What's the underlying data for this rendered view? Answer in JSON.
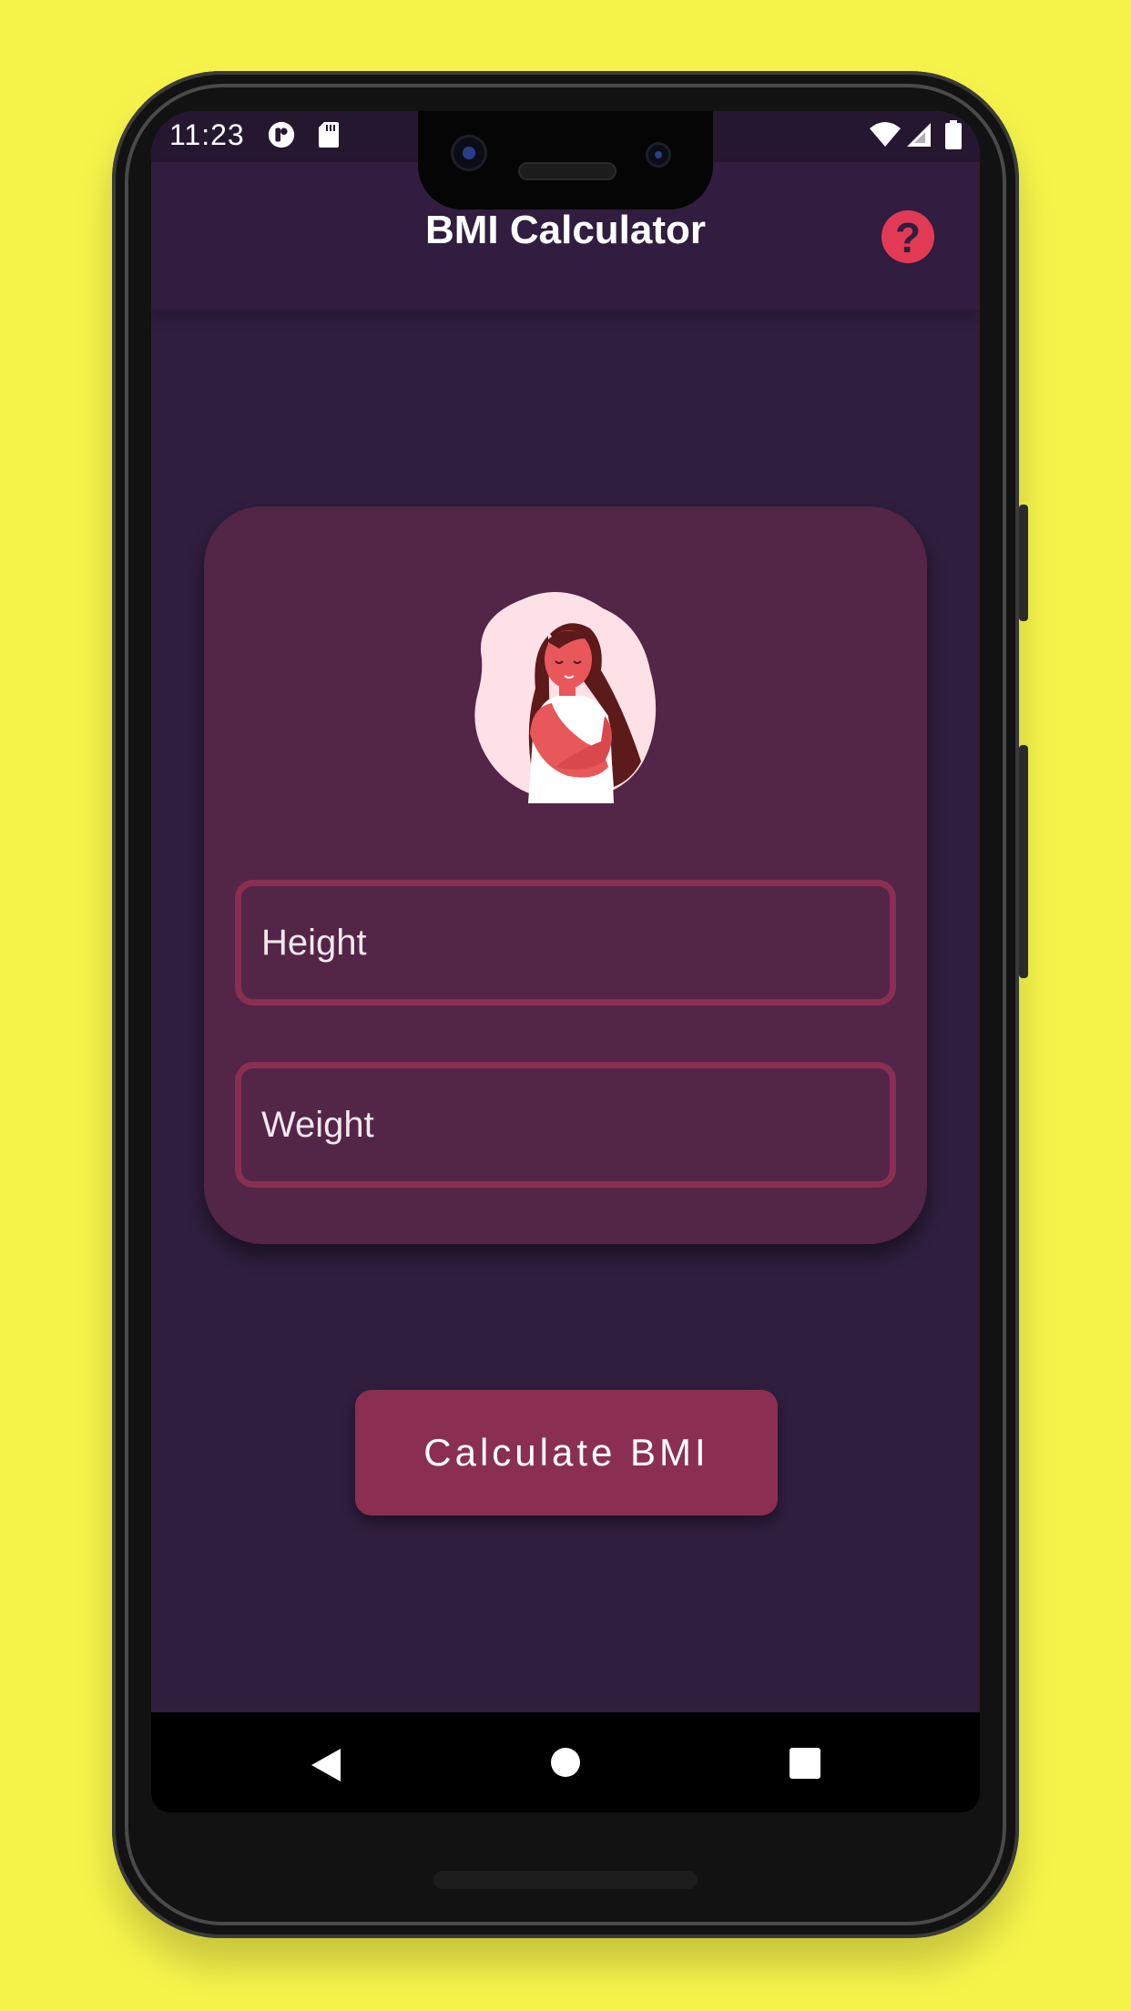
{
  "status_bar": {
    "time": "11:23",
    "left_icons": [
      "app-notification-icon",
      "sd-card-icon"
    ],
    "right_icons": [
      "wifi-icon",
      "cell-signal-icon",
      "battery-icon"
    ]
  },
  "app_bar": {
    "title": "BMI Calculator",
    "help_icon": "question-mark-icon"
  },
  "form": {
    "height_placeholder": "Height",
    "weight_placeholder": "Weight",
    "illustration": "woman-hugging-self-illustration"
  },
  "actions": {
    "calculate_label": "Calculate BMI"
  },
  "nav_bar": {
    "icons": [
      "back-icon",
      "home-icon",
      "recents-icon"
    ]
  },
  "colors": {
    "background": "#f5f34a",
    "screen_bg": "#2f1e3e",
    "card_bg": "#532546",
    "accent": "#8a2f51",
    "help_red": "#e23a55"
  }
}
